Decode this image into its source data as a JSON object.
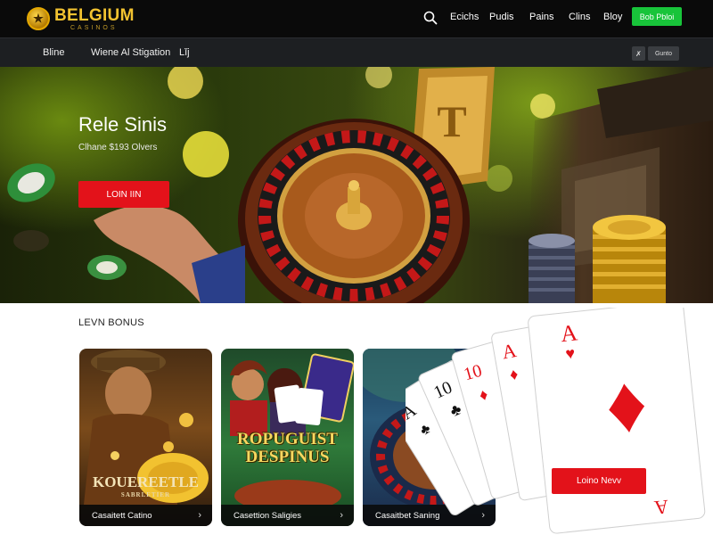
{
  "header": {
    "logo_main": "BELGIUM",
    "logo_sub": "CASINOS",
    "nav": [
      "Ecichs",
      "Pudis",
      "Pains",
      "Clins",
      "Bloy"
    ],
    "cta": "Bob Pbloi"
  },
  "subbar": {
    "items": [
      "Bline",
      "Wiene Al Stigation",
      "Lĭj"
    ],
    "btn1": "✗",
    "btn2": "Gunto"
  },
  "hero": {
    "title": "Rele Sinis",
    "subtitle": "Clhane $193 Olvers",
    "button": "LOIN IIN"
  },
  "section": {
    "label": "LEVN BONUS"
  },
  "cards": [
    {
      "title": "KOUEREETLE",
      "subtitle": "SABRLETIER",
      "caption": "Casaitett Catino"
    },
    {
      "title": "ROPUGUIST DESPINUS",
      "caption": "Casettion Saligies"
    },
    {
      "caption": "Casaitbet Saning"
    }
  ],
  "lower_button": "Loino Nevv",
  "colors": {
    "accent_red": "#e3121a",
    "accent_green": "#18c43a",
    "brand_gold": "#f2c230"
  }
}
